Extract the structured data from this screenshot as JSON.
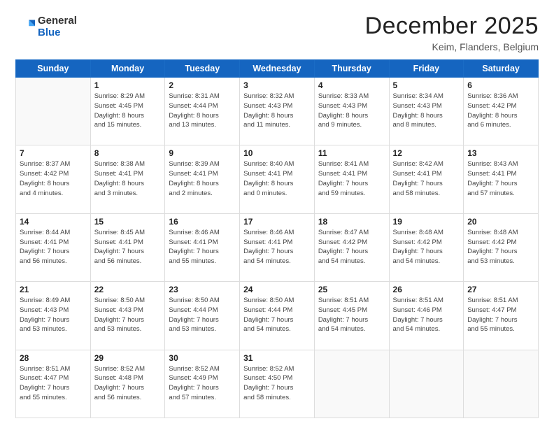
{
  "logo": {
    "general": "General",
    "blue": "Blue"
  },
  "title": {
    "month": "December 2025",
    "location": "Keim, Flanders, Belgium"
  },
  "weekdays": [
    "Sunday",
    "Monday",
    "Tuesday",
    "Wednesday",
    "Thursday",
    "Friday",
    "Saturday"
  ],
  "weeks": [
    [
      {
        "day": null,
        "info": null
      },
      {
        "day": "1",
        "info": "Sunrise: 8:29 AM\nSunset: 4:45 PM\nDaylight: 8 hours\nand 15 minutes."
      },
      {
        "day": "2",
        "info": "Sunrise: 8:31 AM\nSunset: 4:44 PM\nDaylight: 8 hours\nand 13 minutes."
      },
      {
        "day": "3",
        "info": "Sunrise: 8:32 AM\nSunset: 4:43 PM\nDaylight: 8 hours\nand 11 minutes."
      },
      {
        "day": "4",
        "info": "Sunrise: 8:33 AM\nSunset: 4:43 PM\nDaylight: 8 hours\nand 9 minutes."
      },
      {
        "day": "5",
        "info": "Sunrise: 8:34 AM\nSunset: 4:43 PM\nDaylight: 8 hours\nand 8 minutes."
      },
      {
        "day": "6",
        "info": "Sunrise: 8:36 AM\nSunset: 4:42 PM\nDaylight: 8 hours\nand 6 minutes."
      }
    ],
    [
      {
        "day": "7",
        "info": "Sunrise: 8:37 AM\nSunset: 4:42 PM\nDaylight: 8 hours\nand 4 minutes."
      },
      {
        "day": "8",
        "info": "Sunrise: 8:38 AM\nSunset: 4:41 PM\nDaylight: 8 hours\nand 3 minutes."
      },
      {
        "day": "9",
        "info": "Sunrise: 8:39 AM\nSunset: 4:41 PM\nDaylight: 8 hours\nand 2 minutes."
      },
      {
        "day": "10",
        "info": "Sunrise: 8:40 AM\nSunset: 4:41 PM\nDaylight: 8 hours\nand 0 minutes."
      },
      {
        "day": "11",
        "info": "Sunrise: 8:41 AM\nSunset: 4:41 PM\nDaylight: 7 hours\nand 59 minutes."
      },
      {
        "day": "12",
        "info": "Sunrise: 8:42 AM\nSunset: 4:41 PM\nDaylight: 7 hours\nand 58 minutes."
      },
      {
        "day": "13",
        "info": "Sunrise: 8:43 AM\nSunset: 4:41 PM\nDaylight: 7 hours\nand 57 minutes."
      }
    ],
    [
      {
        "day": "14",
        "info": "Sunrise: 8:44 AM\nSunset: 4:41 PM\nDaylight: 7 hours\nand 56 minutes."
      },
      {
        "day": "15",
        "info": "Sunrise: 8:45 AM\nSunset: 4:41 PM\nDaylight: 7 hours\nand 56 minutes."
      },
      {
        "day": "16",
        "info": "Sunrise: 8:46 AM\nSunset: 4:41 PM\nDaylight: 7 hours\nand 55 minutes."
      },
      {
        "day": "17",
        "info": "Sunrise: 8:46 AM\nSunset: 4:41 PM\nDaylight: 7 hours\nand 54 minutes."
      },
      {
        "day": "18",
        "info": "Sunrise: 8:47 AM\nSunset: 4:42 PM\nDaylight: 7 hours\nand 54 minutes."
      },
      {
        "day": "19",
        "info": "Sunrise: 8:48 AM\nSunset: 4:42 PM\nDaylight: 7 hours\nand 54 minutes."
      },
      {
        "day": "20",
        "info": "Sunrise: 8:48 AM\nSunset: 4:42 PM\nDaylight: 7 hours\nand 53 minutes."
      }
    ],
    [
      {
        "day": "21",
        "info": "Sunrise: 8:49 AM\nSunset: 4:43 PM\nDaylight: 7 hours\nand 53 minutes."
      },
      {
        "day": "22",
        "info": "Sunrise: 8:50 AM\nSunset: 4:43 PM\nDaylight: 7 hours\nand 53 minutes."
      },
      {
        "day": "23",
        "info": "Sunrise: 8:50 AM\nSunset: 4:44 PM\nDaylight: 7 hours\nand 53 minutes."
      },
      {
        "day": "24",
        "info": "Sunrise: 8:50 AM\nSunset: 4:44 PM\nDaylight: 7 hours\nand 54 minutes."
      },
      {
        "day": "25",
        "info": "Sunrise: 8:51 AM\nSunset: 4:45 PM\nDaylight: 7 hours\nand 54 minutes."
      },
      {
        "day": "26",
        "info": "Sunrise: 8:51 AM\nSunset: 4:46 PM\nDaylight: 7 hours\nand 54 minutes."
      },
      {
        "day": "27",
        "info": "Sunrise: 8:51 AM\nSunset: 4:47 PM\nDaylight: 7 hours\nand 55 minutes."
      }
    ],
    [
      {
        "day": "28",
        "info": "Sunrise: 8:51 AM\nSunset: 4:47 PM\nDaylight: 7 hours\nand 55 minutes."
      },
      {
        "day": "29",
        "info": "Sunrise: 8:52 AM\nSunset: 4:48 PM\nDaylight: 7 hours\nand 56 minutes."
      },
      {
        "day": "30",
        "info": "Sunrise: 8:52 AM\nSunset: 4:49 PM\nDaylight: 7 hours\nand 57 minutes."
      },
      {
        "day": "31",
        "info": "Sunrise: 8:52 AM\nSunset: 4:50 PM\nDaylight: 7 hours\nand 58 minutes."
      },
      {
        "day": null,
        "info": null
      },
      {
        "day": null,
        "info": null
      },
      {
        "day": null,
        "info": null
      }
    ]
  ]
}
